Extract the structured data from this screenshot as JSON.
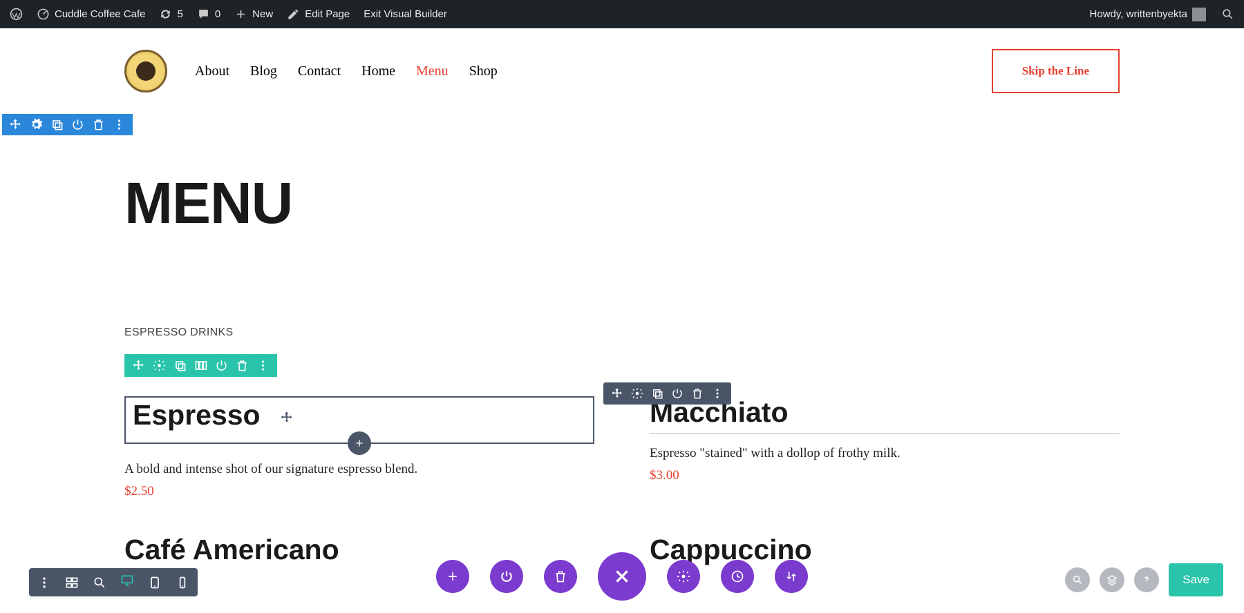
{
  "adminBar": {
    "siteName": "Cuddle Coffee Cafe",
    "updates": "5",
    "comments": "0",
    "newLabel": "New",
    "editPage": "Edit Page",
    "exitBuilder": "Exit Visual Builder",
    "howdy": "Howdy, writtenbyekta"
  },
  "header": {
    "nav": [
      "About",
      "Blog",
      "Contact",
      "Home",
      "Menu",
      "Shop"
    ],
    "activeNav": "Menu",
    "cta": "Skip the Line"
  },
  "page": {
    "title": "MENU",
    "sectionLabel": "ESPRESSO DRINKS"
  },
  "menuItems": [
    {
      "name": "Espresso",
      "desc": "A bold and intense shot of our signature espresso blend.",
      "price": "$2.50"
    },
    {
      "name": "Macchiato",
      "desc": "Espresso \"stained\" with a dollop of frothy milk.",
      "price": "$3.00"
    },
    {
      "name": "Café Americano",
      "desc": "",
      "price": ""
    },
    {
      "name": "Cappuccino",
      "desc": "",
      "price": ""
    }
  ],
  "bottomBar": {
    "save": "Save"
  }
}
